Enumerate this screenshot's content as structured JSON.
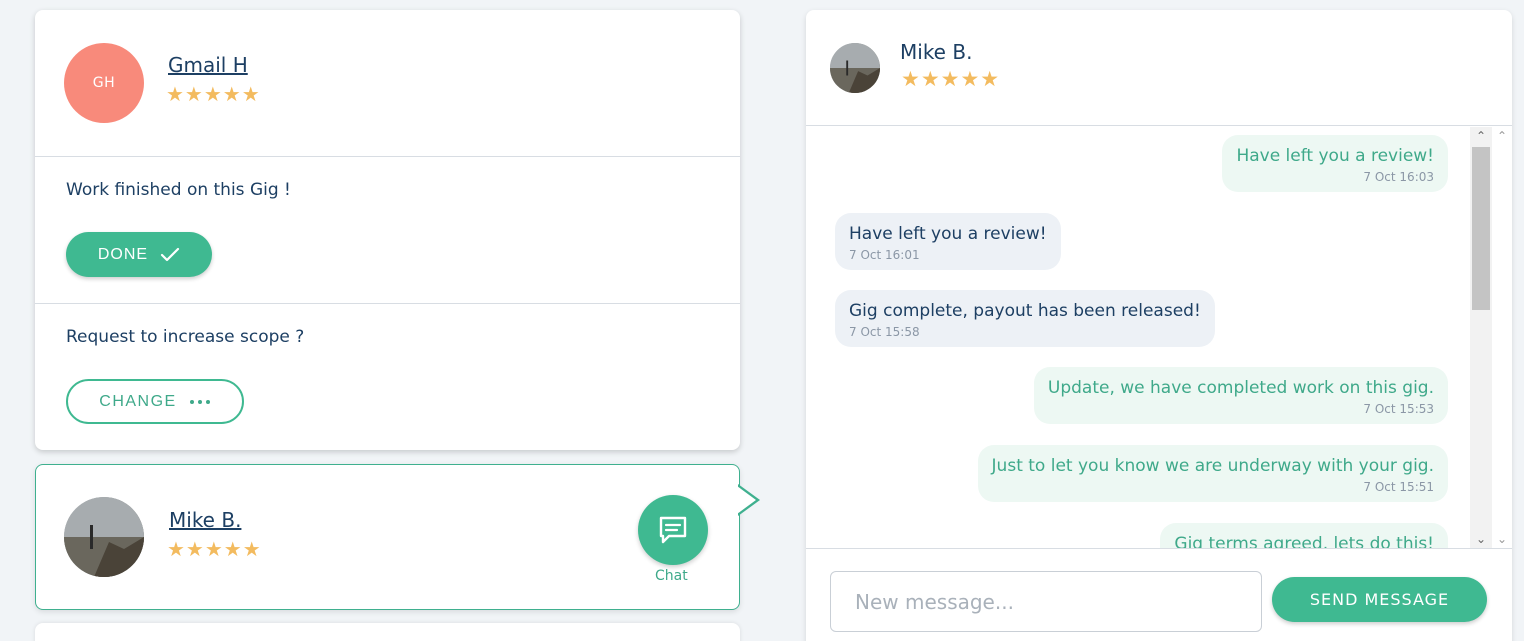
{
  "main_card": {
    "avatar_initials": "GH",
    "user_name": "Gmail H",
    "stars": "★★★★★",
    "work_finished_text": "Work finished on this Gig !",
    "done_button": "DONE",
    "scope_text": "Request to increase scope ?",
    "change_button": "CHANGE"
  },
  "mike_card": {
    "user_name": "Mike B.",
    "stars": "★★★★★",
    "chat_label": "Chat"
  },
  "chat_panel": {
    "header_name": "Mike B.",
    "header_stars": "★★★★★",
    "messages": [
      {
        "direction": "out",
        "text": "Have left you a review!",
        "time": "7 Oct 16:03"
      },
      {
        "direction": "in",
        "text": "Have left you a review!",
        "time": "7 Oct 16:01"
      },
      {
        "direction": "in",
        "text": "Gig complete, payout has been released!",
        "time": "7 Oct 15:58"
      },
      {
        "direction": "out",
        "text": "Update, we have completed work on this gig.",
        "time": "7 Oct 15:53"
      },
      {
        "direction": "out",
        "text": "Just to let you know we are underway with your gig.",
        "time": "7 Oct 15:51"
      },
      {
        "direction": "out",
        "text": "Gig terms agreed, lets do this!",
        "time": ""
      }
    ],
    "input_placeholder": "New message...",
    "send_button": "SEND MESSAGE"
  },
  "colors": {
    "accent": "#3fb991",
    "avatar_initials_bg": "#f88a7b",
    "star": "#f3bb5f",
    "text": "#1d3f63"
  }
}
